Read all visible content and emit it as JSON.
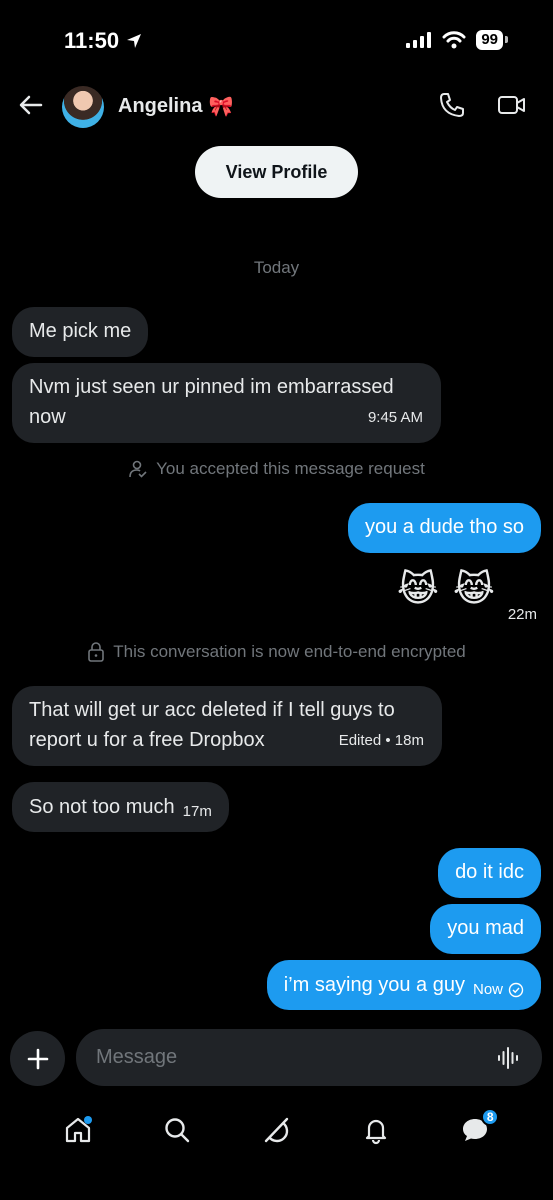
{
  "status_bar": {
    "time": "11:50",
    "battery": "99"
  },
  "header": {
    "name": "Angelina",
    "emoji": "🎀"
  },
  "view_profile_label": "View Profile",
  "day_label": "Today",
  "messages": [
    {
      "text": "Me pick me"
    },
    {
      "text": "Nvm just seen ur pinned im embarrassed now",
      "time": "9:45 AM"
    },
    {
      "text": "you a dude tho so"
    },
    {
      "emoji": [
        "😹",
        "😹"
      ],
      "time": "22m"
    },
    {
      "text": "That will get ur acc deleted if I tell guys to report u  for a free Dropbox",
      "time": "Edited • 18m"
    },
    {
      "text": "So not too much",
      "time": "17m"
    },
    {
      "text": "do it idc"
    },
    {
      "text": "you mad"
    },
    {
      "text": "i’m saying you a guy",
      "time": "Now"
    }
  ],
  "system": {
    "accepted": "You accepted this message request",
    "encrypted": "This conversation is now end-to-end encrypted"
  },
  "composer": {
    "placeholder": "Message"
  },
  "nav": {
    "messages_badge": "8"
  },
  "colors": {
    "accent": "#1d9bf0",
    "incoming": "#202327",
    "background": "#000000"
  }
}
